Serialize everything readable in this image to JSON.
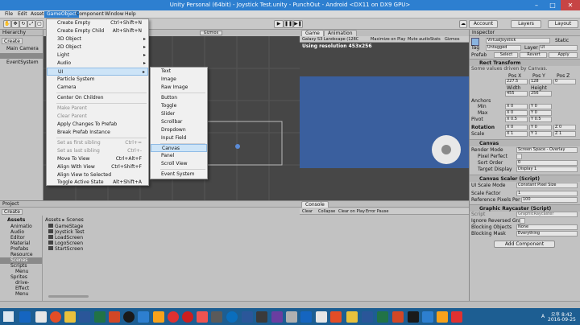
{
  "window": {
    "title": "Unity Personal (64bit) - Joystick Test.unity - PunchOut - Android <DX11 on DX9 GPU>",
    "minimize": "–",
    "maximize": "□",
    "close": "✕"
  },
  "menubar": [
    "File",
    "Edit",
    "Assets",
    "GameObject",
    "Component",
    "Window",
    "Help"
  ],
  "toolbar": {
    "play": "▶",
    "pause": "❚❚",
    "step": "▶❚",
    "account": "Account",
    "layers": "Layers",
    "layout": "Layout",
    "gizmos": "Gizmos"
  },
  "hierarchy": {
    "tab": "Hierarchy",
    "create": "Create",
    "items": [
      "Main Camera",
      "EventSystem"
    ]
  },
  "gameobject_menu": [
    {
      "label": "Create Empty",
      "shortcut": "Ctrl+Shift+N"
    },
    {
      "label": "Create Empty Child",
      "shortcut": "Alt+Shift+N"
    },
    {
      "label": "3D Object",
      "arrow": "▸"
    },
    {
      "label": "2D Object",
      "arrow": "▸"
    },
    {
      "label": "Light",
      "arrow": "▸"
    },
    {
      "label": "Audio",
      "arrow": "▸"
    },
    {
      "label": "UI",
      "arrow": "▸"
    },
    {
      "label": "Particle System"
    },
    {
      "label": "Camera"
    },
    {
      "label": "Center On Children"
    },
    {
      "label": "Make Parent"
    },
    {
      "label": "Clear Parent"
    },
    {
      "label": "Apply Changes To Prefab"
    },
    {
      "label": "Break Prefab Instance"
    },
    {
      "label": "Set as first sibling",
      "shortcut": "Ctrl+="
    },
    {
      "label": "Set as last sibling",
      "shortcut": "Ctrl+-"
    },
    {
      "label": "Move To View",
      "shortcut": "Ctrl+Alt+F"
    },
    {
      "label": "Align With View",
      "shortcut": "Ctrl+Shift+F"
    },
    {
      "label": "Align View to Selected"
    },
    {
      "label": "Toggle Active State",
      "shortcut": "Alt+Shift+A"
    }
  ],
  "ui_submenu": [
    "Text",
    "Image",
    "Raw Image",
    "Button",
    "Toggle",
    "Slider",
    "Scrollbar",
    "Dropdown",
    "Input Field",
    "Canvas",
    "Panel",
    "Scroll View",
    "Event System"
  ],
  "scene": {
    "gizmos": "Gizmos"
  },
  "game": {
    "tab": "Game",
    "anim_tab": "Animation",
    "resolution_select": "Galaxy S3 Landscape (128C",
    "maximize": "Maximize on Play",
    "mute": "Mute audio",
    "stats": "Stats",
    "gizmos": "Gizmos",
    "status": "Using resolution 453x256",
    "colors": {
      "bar": "#3a5f9e",
      "frame": "#3a3a3a"
    }
  },
  "project": {
    "tab": "Project",
    "create": "Create",
    "tree_root": "Assets",
    "tree": [
      "Animatio",
      "Audio",
      "Editor",
      "Material",
      "Prefabs",
      "Resource",
      "Scenes",
      "Scripts",
      "Menu",
      "Sprites",
      "drive-",
      "Effect",
      "Menu"
    ],
    "breadcrumb": "Assets ▸ Scenes",
    "files": [
      "GameStage",
      "Joystick Test",
      "LoadScreen",
      "LogoScreen",
      "StartScreen"
    ]
  },
  "console": {
    "tab": "Console",
    "buttons": [
      "Clear",
      "Collapse",
      "Clear on Play",
      "Error Pause"
    ]
  },
  "inspector": {
    "tab": "Inspector",
    "object_name": "VirtualJoystick",
    "static": "Static",
    "tag_label": "Tag",
    "tag": "Untagged",
    "layer_label": "Layer",
    "layer": "UI",
    "prefab_label": "Prefab",
    "prefab_select": "Select",
    "prefab_revert": "Revert",
    "prefab_apply": "Apply",
    "rect": {
      "title": "Rect Transform",
      "note": "Some values driven by Canvas.",
      "h_posx": "Pos X",
      "h_posy": "Pos Y",
      "h_posz": "Pos Z",
      "posx": "227.5",
      "posy": "128",
      "posz": "0",
      "h_width": "Width",
      "h_height": "Height",
      "width": "455",
      "height": "256"
    },
    "anchors": {
      "label": "Anchors",
      "min": "Min",
      "max": "Max",
      "min_x": "X 0",
      "min_y": "Y 0",
      "max_x": "X 0",
      "max_y": "Y 0"
    },
    "pivot": {
      "label": "Pivot",
      "x": "X 0.5",
      "y": "Y 0.5"
    },
    "rotation": {
      "label": "Rotation",
      "x": "X 0",
      "y": "Y 0",
      "z": "Z 0"
    },
    "scale": {
      "label": "Scale",
      "x": "X 1",
      "y": "Y 1",
      "z": "Z 1"
    },
    "canvas": {
      "title": "Canvas",
      "render_mode_label": "Render Mode",
      "render_mode": "Screen Space - Overlay",
      "pixel_perfect": "Pixel Perfect",
      "sort_order_label": "Sort Order",
      "sort_order": "0",
      "target_display_label": "Target Display",
      "target_display": "Display 1"
    },
    "scaler": {
      "title": "Canvas Scaler (Script)",
      "mode_label": "UI Scale Mode",
      "mode": "Constant Pixel Size",
      "factor_label": "Scale Factor",
      "factor": "1",
      "ref_label": "Reference Pixels Per",
      "ref": "100"
    },
    "raycaster": {
      "title": "Graphic Raycaster (Script)",
      "script_label": "Script",
      "script": "GraphicRaycaster",
      "ignore": "Ignore Reversed Gra",
      "blocking_objects_label": "Blocking Objects",
      "blocking_objects": "None",
      "blocking_mask_label": "Blocking Mask",
      "blocking_mask": "Everything"
    },
    "add_component": "Add Component"
  },
  "taskbar": {
    "time": "오후 8:42",
    "date": "2016-09-25",
    "ime": "A",
    "colors": [
      "#1565c0",
      "#e6e6e6",
      "#e44d26",
      "#e8c13c",
      "#2a5699",
      "#217346",
      "#d24726",
      "#1a1a1a",
      "#2d7fd0",
      "#f7a21b",
      "#e03131",
      "#cc1e1e",
      "#ef5350",
      "#5a5a5a",
      "#0a6ebd",
      "#2b579a",
      "#3a3a3a",
      "#6a3ea1",
      "#b0b0b0"
    ]
  }
}
